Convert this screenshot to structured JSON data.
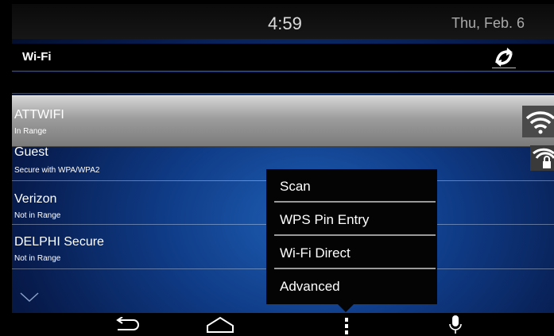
{
  "status": {
    "time": "4:59",
    "date": "Thu, Feb. 6"
  },
  "header": {
    "title": "Wi-Fi",
    "refresh_icon": "wifi-refresh-icon"
  },
  "networks": [
    {
      "name": "ATTWIFI",
      "status": "In Range",
      "selected": true,
      "icon": "wifi-signal-icon"
    },
    {
      "name": "Guest",
      "status": "Secure with WPA/WPA2",
      "icon": "wifi-locked-icon"
    },
    {
      "name": "Verizon",
      "status": "Not in Range"
    },
    {
      "name": "DELPHI Secure",
      "status": "Not in Range"
    }
  ],
  "menu": {
    "items": [
      {
        "label": "Scan"
      },
      {
        "label": "WPS Pin Entry"
      },
      {
        "label": "Wi-Fi Direct"
      },
      {
        "label": "Advanced"
      }
    ]
  },
  "navbar": {
    "icons": [
      "back-icon",
      "home-icon",
      "menu-icon",
      "microphone-icon"
    ]
  },
  "colors": {
    "background": "#0f3b86",
    "selected_row": "#9c9c9c",
    "menu_bg": "#040404"
  }
}
